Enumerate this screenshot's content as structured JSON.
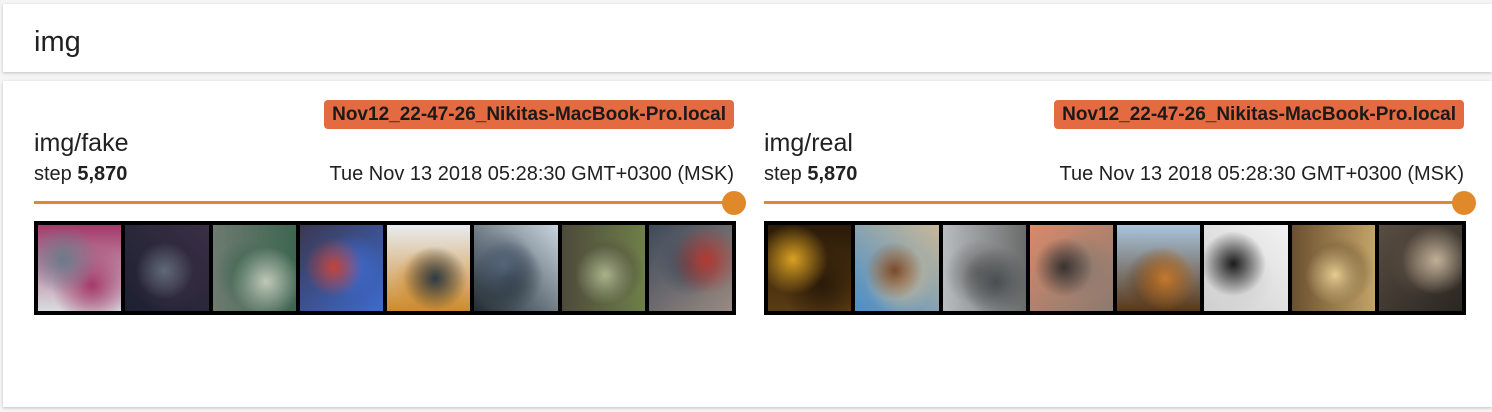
{
  "header": {
    "title": "img"
  },
  "panels": [
    {
      "title": "img/fake",
      "run": "Nov12_22-47-26_Nikitas-MacBook-Pro.local",
      "step_label": "step",
      "step_value": "5,870",
      "timestamp": "Tue Nov 13 2018 05:28:30 GMT+0300 (MSK)",
      "thumbnails": [
        {
          "colors": [
            "#d8dde0",
            "#6b7a8a",
            "#a43a6a"
          ]
        },
        {
          "colors": [
            "#1c2030",
            "#5f6a78",
            "#3a2f46"
          ]
        },
        {
          "colors": [
            "#6d7a70",
            "#c0c8b8",
            "#3d6650"
          ]
        },
        {
          "colors": [
            "#3b3850",
            "#c2433a",
            "#3d6ad0"
          ]
        },
        {
          "colors": [
            "#e8ecef",
            "#2d3b46",
            "#cf8a2a"
          ]
        },
        {
          "colors": [
            "#c8d4de",
            "#56657a",
            "#1f2a33"
          ]
        },
        {
          "colors": [
            "#6f7f4a",
            "#a8b48a",
            "#4d4a3a"
          ]
        },
        {
          "colors": [
            "#9a8a82",
            "#b33a33",
            "#3e4a5a"
          ]
        }
      ]
    },
    {
      "title": "img/real",
      "run": "Nov12_22-47-26_Nikitas-MacBook-Pro.local",
      "step_label": "step",
      "step_value": "5,870",
      "timestamp": "Tue Nov 13 2018 05:28:30 GMT+0300 (MSK)",
      "thumbnails": [
        {
          "colors": [
            "#5a3c14",
            "#d9a022",
            "#2a1a08"
          ]
        },
        {
          "colors": [
            "#4a8ec8",
            "#7a4a2a",
            "#c8b898"
          ]
        },
        {
          "colors": [
            "#b8bcc0",
            "#4a4e50",
            "#6a6c6a"
          ]
        },
        {
          "colors": [
            "#d88a6a",
            "#3a3230",
            "#8a7a70"
          ]
        },
        {
          "colors": [
            "#a8c4dc",
            "#c47a30",
            "#5a3818"
          ]
        },
        {
          "colors": [
            "#f2f2f2",
            "#1a1a1a",
            "#cfcfcf"
          ]
        },
        {
          "colors": [
            "#c2a468",
            "#e6cc90",
            "#6a5030"
          ]
        },
        {
          "colors": [
            "#2a2622",
            "#c0b098",
            "#5a4e42"
          ]
        }
      ]
    }
  ]
}
